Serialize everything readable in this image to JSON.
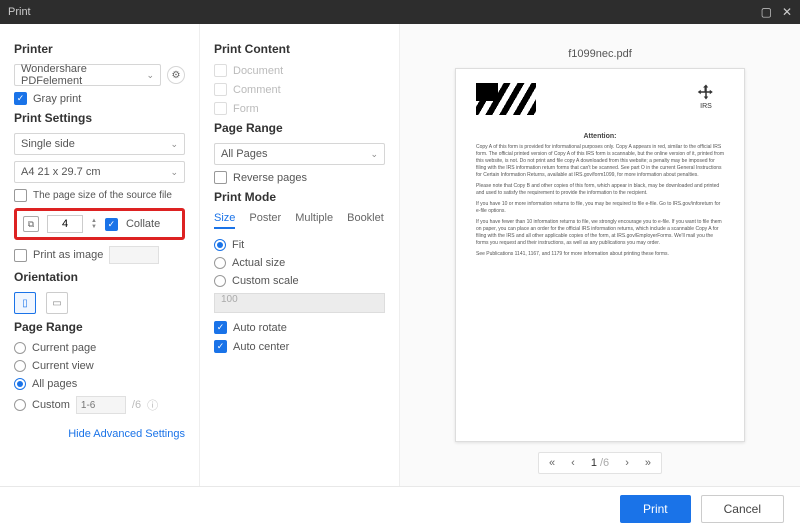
{
  "titlebar": {
    "title": "Print"
  },
  "left": {
    "printer_header": "Printer",
    "printer_name": "Wondershare PDFelement",
    "gray_print": "Gray print",
    "settings_header": "Print Settings",
    "sides": "Single side",
    "paper": "A4 21 x 29.7 cm",
    "page_size_source": "The page size of the source file",
    "copies": "4",
    "collate": "Collate",
    "print_as_image": "Print as image",
    "orientation_header": "Orientation",
    "page_range_header": "Page Range",
    "current_page": "Current page",
    "current_view": "Current view",
    "all_pages": "All pages",
    "custom": "Custom",
    "custom_placeholder": "1-6",
    "custom_suffix": "/6",
    "advanced_link": "Hide Advanced Settings"
  },
  "mid": {
    "content_header": "Print Content",
    "document": "Document",
    "comment": "Comment",
    "form": "Form",
    "page_range_header": "Page Range",
    "all_pages": "All Pages",
    "reverse": "Reverse pages",
    "mode_header": "Print Mode",
    "tabs": {
      "size": "Size",
      "poster": "Poster",
      "multiple": "Multiple",
      "booklet": "Booklet"
    },
    "fit": "Fit",
    "actual": "Actual size",
    "custom_scale": "Custom scale",
    "scale_value": "100",
    "auto_rotate": "Auto rotate",
    "auto_center": "Auto center"
  },
  "preview": {
    "filename": "f1099nec.pdf",
    "attention": "Attention:",
    "p1": "Copy A of this form is provided for informational purposes only. Copy A appears in red, similar to the official IRS form. The official printed version of Copy A of this IRS form is scannable, but the online version of it, printed from this website, is not. Do not print and file copy A downloaded from this website; a penalty may be imposed for filing with the IRS information return forms that can't be scanned. See part O in the current General Instructions for Certain Information Returns, available at IRS.gov/form1099, for more information about penalties.",
    "p2": "Please note that Copy B and other copies of this form, which appear in black, may be downloaded and printed and used to satisfy the requirement to provide the information to the recipient.",
    "p3": "If you have 10 or more information returns to file, you may be required to file e-file. Go to IRS.gov/inforeturn for e-file options.",
    "p4": "If you have fewer than 10 information returns to file, we strongly encourage you to e-file. If you want to file them on paper, you can place an order for the official IRS information returns, which include a scannable Copy A for filing with the IRS and all other applicable copies of the form, at IRS.gov/EmployerForms. We'll mail you the forms you request and their instructions, as well as any publications you may order.",
    "p5": "See Publications 1141, 1167, and 1179 for more information about printing these forms.",
    "page_current": "1",
    "page_total": "/6"
  },
  "footer": {
    "print": "Print",
    "cancel": "Cancel"
  }
}
